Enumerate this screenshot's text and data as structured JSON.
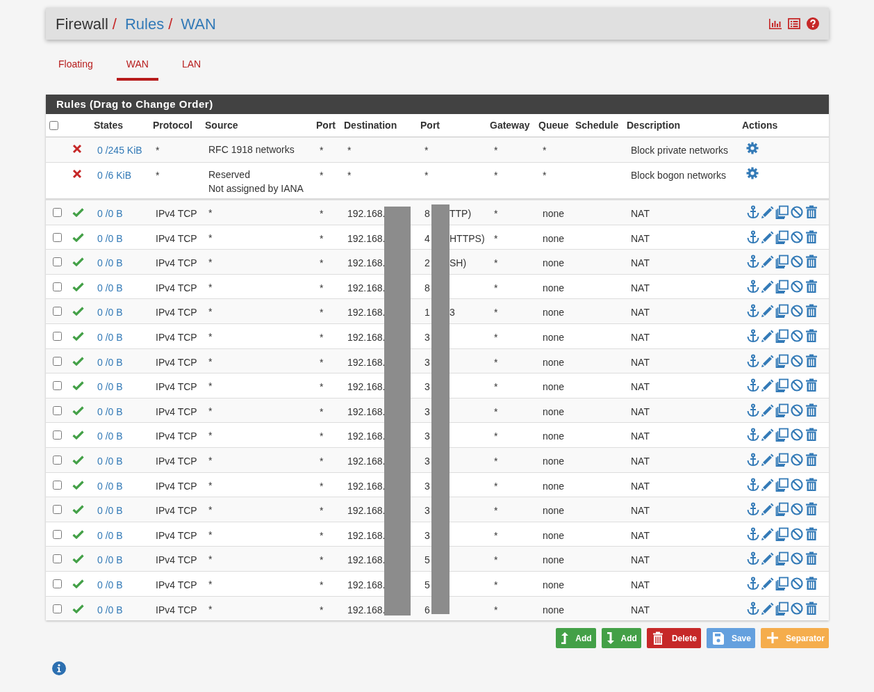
{
  "breadcrumb": {
    "separator": "/",
    "items": [
      {
        "label": "Firewall",
        "link": false
      },
      {
        "label": "Rules",
        "link": true
      },
      {
        "label": "WAN",
        "link": true
      }
    ]
  },
  "tabs": [
    {
      "label": "Floating",
      "selected": false
    },
    {
      "label": "WAN",
      "selected": true
    },
    {
      "label": "LAN",
      "selected": false
    }
  ],
  "panel": {
    "title": "Rules (Drag to Change Order)"
  },
  "table": {
    "columns": [
      "",
      "",
      "States",
      "Protocol",
      "Source",
      "Port",
      "Destination",
      "Port",
      "Gateway",
      "Queue",
      "Schedule",
      "Description",
      "Actions"
    ],
    "header_checkbox": {
      "checked": false
    },
    "rows": [
      {
        "kind": "block",
        "states": "0 /245 KiB",
        "protocol": "*",
        "source": [
          "RFC 1918 networks"
        ],
        "source_port": "*",
        "destination": "*",
        "port_start": "*",
        "port_end": "",
        "gateway": "*",
        "queue": "*",
        "description": "Block private networks"
      },
      {
        "kind": "block",
        "states": "0 /6 KiB",
        "protocol": "*",
        "source": [
          "Reserved",
          "Not assigned by IANA"
        ],
        "source_port": "*",
        "destination": "*",
        "port_start": "*",
        "port_end": "",
        "gateway": "*",
        "queue": "*",
        "description": "Block bogon networks"
      },
      {
        "kind": "pass",
        "checked": false,
        "states": "0 /0 B",
        "protocol": "IPv4 TCP",
        "source": [
          "*"
        ],
        "source_port": "*",
        "destination": "192.168.",
        "port_start": "8",
        "port_end": "TTP)",
        "gateway": "*",
        "queue": "none",
        "description": "NAT"
      },
      {
        "kind": "pass",
        "checked": false,
        "states": "0 /0 B",
        "protocol": "IPv4 TCP",
        "source": [
          "*"
        ],
        "source_port": "*",
        "destination": "192.168.",
        "port_start": "4",
        "port_end": "HTTPS)",
        "gateway": "*",
        "queue": "none",
        "description": "NAT"
      },
      {
        "kind": "pass",
        "checked": false,
        "states": "0 /0 B",
        "protocol": "IPv4 TCP",
        "source": [
          "*"
        ],
        "source_port": "*",
        "destination": "192.168.",
        "port_start": "2",
        "port_end": "SH)",
        "gateway": "*",
        "queue": "none",
        "description": "NAT"
      },
      {
        "kind": "pass",
        "checked": false,
        "states": "0 /0 B",
        "protocol": "IPv4 TCP",
        "source": [
          "*"
        ],
        "source_port": "*",
        "destination": "192.168.",
        "port_start": "8",
        "port_end": "",
        "gateway": "*",
        "queue": "none",
        "description": "NAT"
      },
      {
        "kind": "pass",
        "checked": false,
        "states": "0 /0 B",
        "protocol": "IPv4 TCP",
        "source": [
          "*"
        ],
        "source_port": "*",
        "destination": "192.168.",
        "port_start": "1",
        "port_end": "3",
        "gateway": "*",
        "queue": "none",
        "description": "NAT"
      },
      {
        "kind": "pass",
        "checked": false,
        "states": "0 /0 B",
        "protocol": "IPv4 TCP",
        "source": [
          "*"
        ],
        "source_port": "*",
        "destination": "192.168.",
        "port_start": "3",
        "port_end": "",
        "gateway": "*",
        "queue": "none",
        "description": "NAT"
      },
      {
        "kind": "pass",
        "checked": false,
        "states": "0 /0 B",
        "protocol": "IPv4 TCP",
        "source": [
          "*"
        ],
        "source_port": "*",
        "destination": "192.168.",
        "port_start": "3",
        "port_end": "",
        "gateway": "*",
        "queue": "none",
        "description": "NAT"
      },
      {
        "kind": "pass",
        "checked": false,
        "states": "0 /0 B",
        "protocol": "IPv4 TCP",
        "source": [
          "*"
        ],
        "source_port": "*",
        "destination": "192.168.",
        "port_start": "3",
        "port_end": "",
        "gateway": "*",
        "queue": "none",
        "description": "NAT"
      },
      {
        "kind": "pass",
        "checked": false,
        "states": "0 /0 B",
        "protocol": "IPv4 TCP",
        "source": [
          "*"
        ],
        "source_port": "*",
        "destination": "192.168.",
        "port_start": "3",
        "port_end": "",
        "gateway": "*",
        "queue": "none",
        "description": "NAT"
      },
      {
        "kind": "pass",
        "checked": false,
        "states": "0 /0 B",
        "protocol": "IPv4 TCP",
        "source": [
          "*"
        ],
        "source_port": "*",
        "destination": "192.168.",
        "port_start": "3",
        "port_end": "",
        "gateway": "*",
        "queue": "none",
        "description": "NAT"
      },
      {
        "kind": "pass",
        "checked": false,
        "states": "0 /0 B",
        "protocol": "IPv4 TCP",
        "source": [
          "*"
        ],
        "source_port": "*",
        "destination": "192.168.",
        "port_start": "3",
        "port_end": "",
        "gateway": "*",
        "queue": "none",
        "description": "NAT"
      },
      {
        "kind": "pass",
        "checked": false,
        "states": "0 /0 B",
        "protocol": "IPv4 TCP",
        "source": [
          "*"
        ],
        "source_port": "*",
        "destination": "192.168.",
        "port_start": "3",
        "port_end": "",
        "gateway": "*",
        "queue": "none",
        "description": "NAT"
      },
      {
        "kind": "pass",
        "checked": false,
        "states": "0 /0 B",
        "protocol": "IPv4 TCP",
        "source": [
          "*"
        ],
        "source_port": "*",
        "destination": "192.168.",
        "port_start": "3",
        "port_end": "",
        "gateway": "*",
        "queue": "none",
        "description": "NAT"
      },
      {
        "kind": "pass",
        "checked": false,
        "states": "0 /0 B",
        "protocol": "IPv4 TCP",
        "source": [
          "*"
        ],
        "source_port": "*",
        "destination": "192.168.",
        "port_start": "3",
        "port_end": "",
        "gateway": "*",
        "queue": "none",
        "description": "NAT"
      },
      {
        "kind": "pass",
        "checked": false,
        "states": "0 /0 B",
        "protocol": "IPv4 TCP",
        "source": [
          "*"
        ],
        "source_port": "*",
        "destination": "192.168.",
        "port_start": "5",
        "port_end": "",
        "gateway": "*",
        "queue": "none",
        "description": "NAT"
      },
      {
        "kind": "pass",
        "checked": false,
        "states": "0 /0 B",
        "protocol": "IPv4 TCP",
        "source": [
          "*"
        ],
        "source_port": "*",
        "destination": "192.168.",
        "port_start": "5",
        "port_end": "",
        "gateway": "*",
        "queue": "none",
        "description": "NAT"
      },
      {
        "kind": "pass",
        "checked": false,
        "states": "0 /0 B",
        "protocol": "IPv4 TCP",
        "source": [
          "*"
        ],
        "source_port": "*",
        "destination": "192.168.",
        "port_start": "6",
        "port_end": "",
        "gateway": "*",
        "queue": "none",
        "description": "NAT"
      }
    ]
  },
  "buttons": [
    {
      "kind": "add_top",
      "label": "Add"
    },
    {
      "kind": "add_bottom",
      "label": "Add"
    },
    {
      "kind": "delete",
      "label": "Delete"
    },
    {
      "kind": "save",
      "label": "Save"
    },
    {
      "kind": "separator",
      "label": "Separator"
    }
  ]
}
